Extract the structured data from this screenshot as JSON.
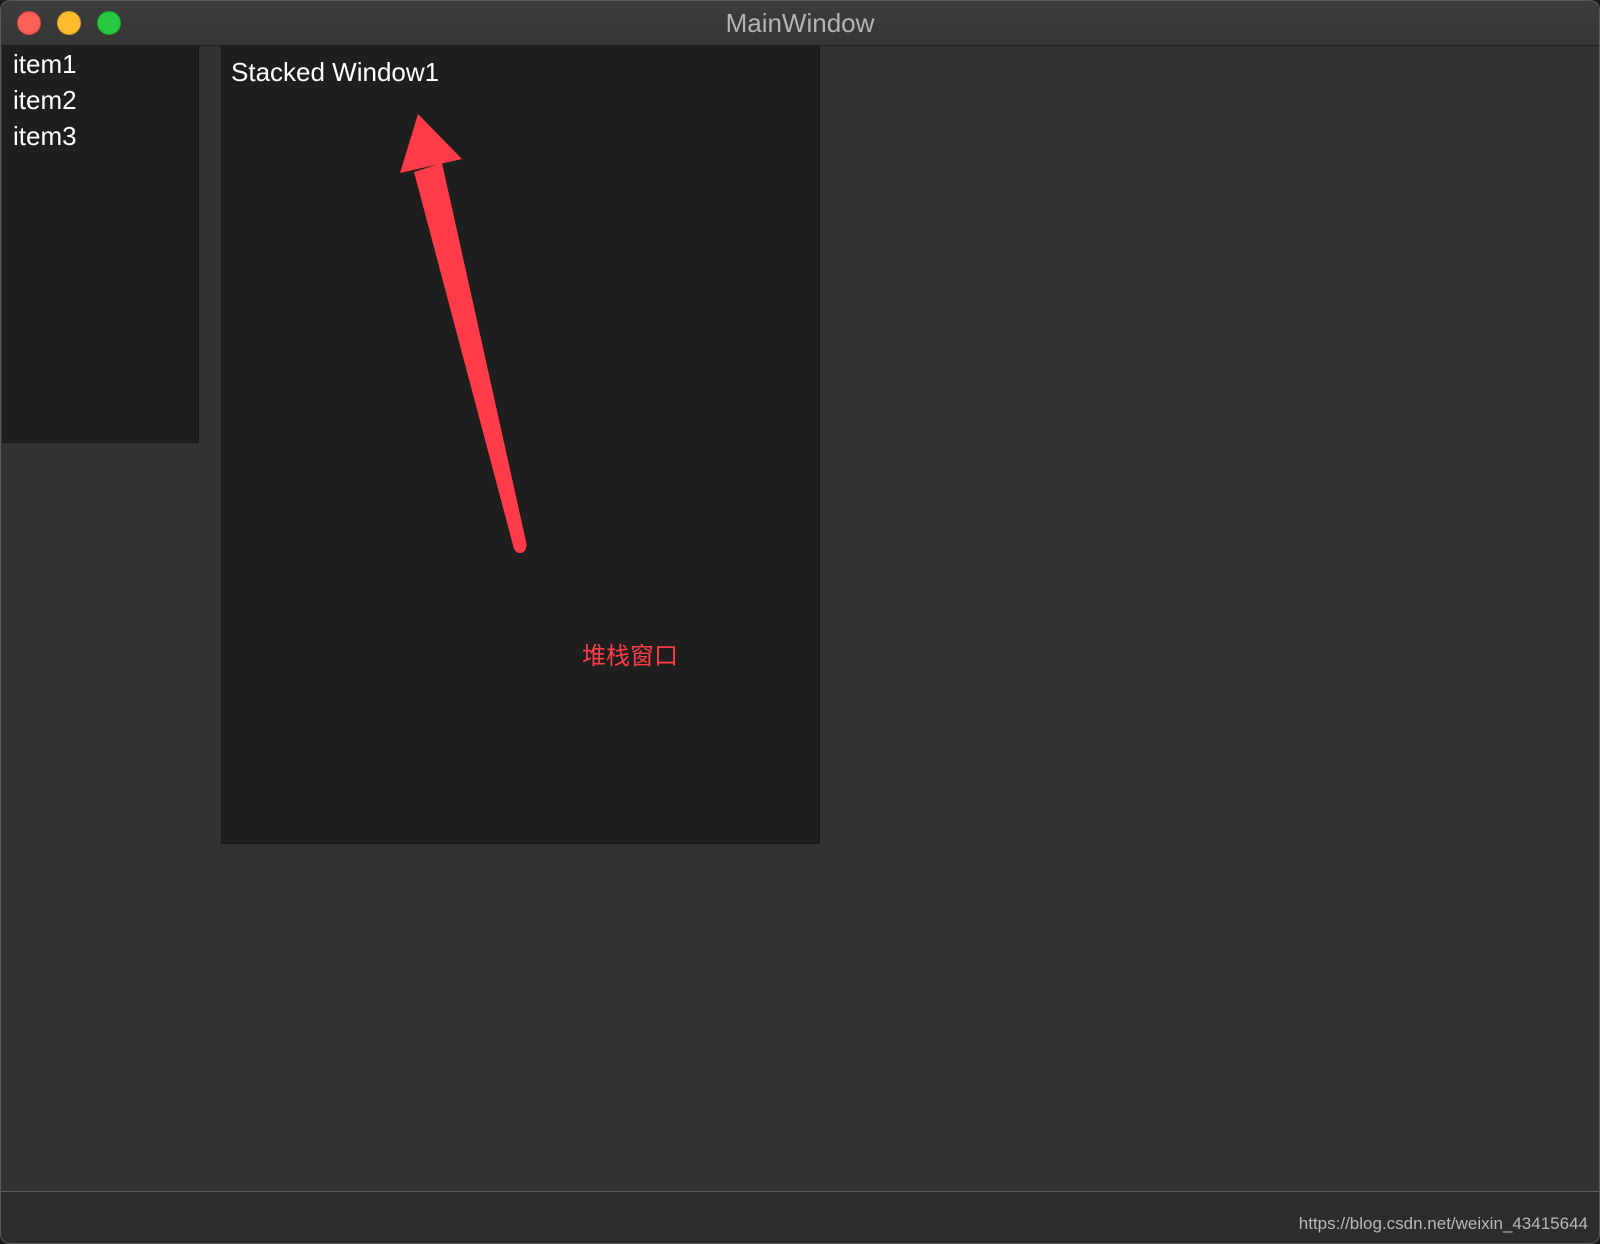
{
  "window": {
    "title": "MainWindow"
  },
  "list": {
    "items": [
      {
        "label": "item1"
      },
      {
        "label": "item2"
      },
      {
        "label": "item3"
      }
    ]
  },
  "stacked": {
    "label": "Stacked Window1"
  },
  "annotation": {
    "text": "堆栈窗口",
    "color": "#ff3b49"
  },
  "watermark": {
    "text": "https://blog.csdn.net/weixin_43415644"
  },
  "colors": {
    "background": "#323232",
    "panel": "#1e1e1e",
    "close": "#fe5f57",
    "minimize": "#febc2e",
    "maximize": "#28c840"
  }
}
